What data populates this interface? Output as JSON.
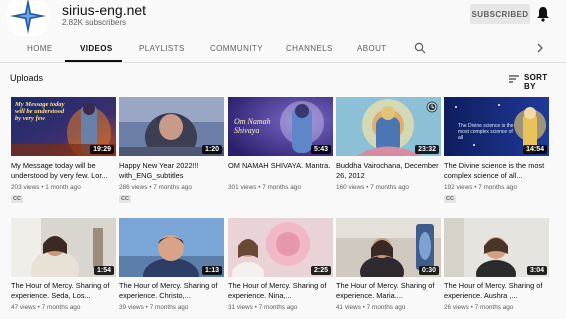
{
  "channel": {
    "name": "sirius-eng.net",
    "subscribers": "2.82K subscribers",
    "subscribe_label": "SUBSCRIBED"
  },
  "tabs": [
    {
      "label": "HOME"
    },
    {
      "label": "VIDEOS"
    },
    {
      "label": "PLAYLISTS"
    },
    {
      "label": "COMMUNITY"
    },
    {
      "label": "CHANNELS"
    },
    {
      "label": "ABOUT"
    }
  ],
  "section": {
    "title": "Uploads",
    "sort_label": "SORT BY"
  },
  "videos": [
    {
      "title": "My Message today will be understood by very few. Lor...",
      "views": "203 views",
      "age": "1 month ago",
      "duration": "19:29",
      "cc": "CC"
    },
    {
      "title": "Happy New Year 2022!!! with_ENG_subtitles",
      "views": "286 views",
      "age": "7 months ago",
      "duration": "1:20",
      "cc": "CC"
    },
    {
      "title": "OM NAMAH SHIVAYA. Mantra.",
      "views": "301 views",
      "age": "7 months ago",
      "duration": "5:43",
      "cc": ""
    },
    {
      "title": "Buddha Vairochana, December 26, 2012",
      "views": "160 views",
      "age": "7 months ago",
      "duration": "23:32",
      "cc": ""
    },
    {
      "title": "The Divine science is the most complex science of all...",
      "views": "192 views",
      "age": "7 months ago",
      "duration": "14:54",
      "cc": "CC"
    },
    {
      "title": "The Hour of Mercy. Sharing of experience. Seda, Los...",
      "views": "47 views",
      "age": "7 months ago",
      "duration": "1:54",
      "cc": ""
    },
    {
      "title": "The Hour of Mercy. Sharing of experience. Christo,...",
      "views": "39 views",
      "age": "7 months ago",
      "duration": "1:13",
      "cc": ""
    },
    {
      "title": "The Hour of Mercy. Sharing of experience. Nina,...",
      "views": "31 views",
      "age": "7 months ago",
      "duration": "2:25",
      "cc": ""
    },
    {
      "title": "The Hour of Mercy. Sharing of experience. Maria....",
      "views": "41 views",
      "age": "7 months ago",
      "duration": "0:30",
      "cc": ""
    },
    {
      "title": "The Hour of Mercy. Sharing of experience. Aushra ,...",
      "views": "26 views",
      "age": "7 months ago",
      "duration": "3:04",
      "cc": ""
    }
  ],
  "overlay_text": {
    "v1_line1": "My Message today",
    "v1_line2": "will be understood",
    "v1_line3": "by very few",
    "v3_text": "Om Namah Shivaya",
    "v5_text": "The Divine science is the most complex science of all"
  },
  "colors": {
    "accent": "#0f0f0f",
    "muted": "#606060",
    "background": "#f9f9f9"
  }
}
